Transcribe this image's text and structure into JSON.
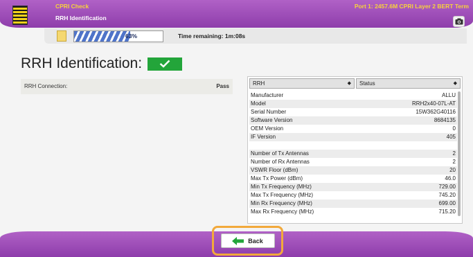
{
  "header": {
    "title": "CPRI Check",
    "subtitle": "RRH Identification",
    "port_info": "Port 1: 2457.6M CPRI Layer 2 BERT Term"
  },
  "status": {
    "progress_percent": 63,
    "progress_label": "63%",
    "time_remaining": "Time remaining: 1m:08s"
  },
  "page": {
    "title": "RRH Identification:",
    "result": "pass"
  },
  "connection": {
    "label": "RRH Connection:",
    "value": "Pass"
  },
  "table": {
    "col1": "RRH",
    "col2": "Status",
    "rows": [
      {
        "label": "Manufacturer",
        "value": "ALLU"
      },
      {
        "label": "Model",
        "value": "RRH2x40-07L-AT"
      },
      {
        "label": "Serial Number",
        "value": "15W362G40116"
      },
      {
        "label": "Software Version",
        "value": "8684135"
      },
      {
        "label": "OEM Version",
        "value": "0"
      },
      {
        "label": "IF Version",
        "value": "405"
      },
      {
        "label": "",
        "value": ""
      },
      {
        "label": "Number of Tx Antennas",
        "value": "2"
      },
      {
        "label": "Number of Rx Antennas",
        "value": "2"
      },
      {
        "label": "VSWR Floor (dBm)",
        "value": "20"
      },
      {
        "label": "Max Tx Power (dBm)",
        "value": "46.0"
      },
      {
        "label": "Min Tx Frequency (MHz)",
        "value": "729.00"
      },
      {
        "label": "Max Tx Frequency (MHz)",
        "value": "745.20"
      },
      {
        "label": "Min Rx Frequency (MHz)",
        "value": "699.00"
      },
      {
        "label": "Max Rx Frequency (MHz)",
        "value": "715.20"
      }
    ]
  },
  "footer": {
    "back_label": "Back"
  },
  "colors": {
    "accent": "#9b4bb8",
    "header_title": "#f7d23c",
    "pass": "#23a53a",
    "highlight": "#f2a93b"
  }
}
